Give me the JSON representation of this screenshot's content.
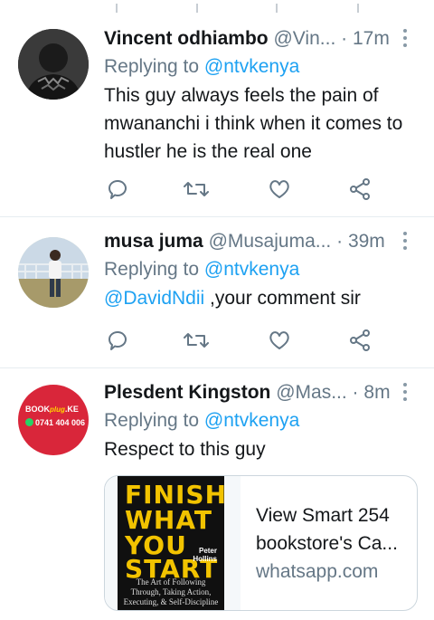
{
  "colors": {
    "link": "#1da1f2",
    "muted": "#657786",
    "text": "#14171a",
    "divider": "#e6ecf0",
    "avatar3_bg": "#d9263a"
  },
  "tweets": [
    {
      "name": "Vincent odhiambo",
      "handle": "@Vin...",
      "separator": "·",
      "time": "17m",
      "replying_prefix": "Replying to",
      "replying_to": "@ntvkenya",
      "text": "This guy always feels the pain of mwananchi i think when it comes to hustler he is the real one",
      "avatar_icon": "profile-photo"
    },
    {
      "name": "musa juma",
      "handle": "@Musajuma...",
      "separator": "·",
      "time": "39m",
      "replying_prefix": "Replying to",
      "replying_to": "@ntvkenya",
      "text_mention": "@DavidNdii",
      "text": " ,your comment sir",
      "avatar_icon": "profile-photo"
    },
    {
      "name": "Plesdent Kingston",
      "handle": "@Mas...",
      "separator": "·",
      "time": "8m",
      "replying_prefix": "Replying to",
      "replying_to": "@ntvkenya",
      "text": "Respect to this guy",
      "avatar_logo": {
        "brand_left": "BOOK",
        "brand_mid": "plug",
        "brand_right": ".KE",
        "phone": "0741 404 006"
      },
      "card": {
        "title": "View Smart 254 bookstore's Ca...",
        "domain": "whatsapp.com",
        "book": {
          "line1": "FINISH",
          "line2": "WHAT",
          "line3": "YOU",
          "line4": "START",
          "author": "Peter Hollins",
          "subtitle": "The Art of Following Through, Taking Action, Executing, & Self-Discipline"
        }
      }
    }
  ],
  "actions": {
    "icons": [
      "reply-icon",
      "retweet-icon",
      "like-icon",
      "share-icon"
    ]
  }
}
